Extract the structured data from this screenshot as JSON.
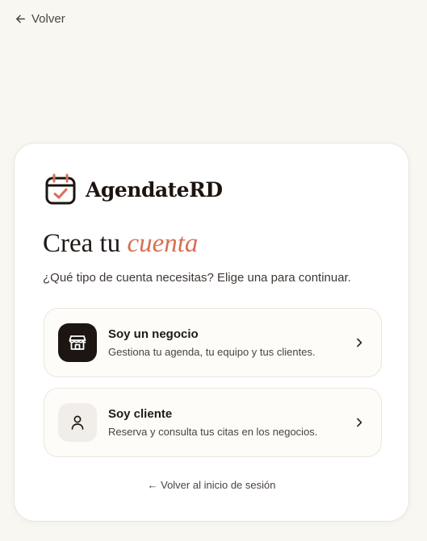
{
  "nav": {
    "back_label": "Volver"
  },
  "brand": {
    "name": "AgendateRD",
    "accent_color": "#d96f52"
  },
  "heading": {
    "title_main": "Crea tu",
    "title_accent": "cuenta",
    "subtitle": "¿Qué tipo de cuenta necesitas? Elige una para continuar."
  },
  "options": [
    {
      "title": "Soy un negocio",
      "description": "Gestiona tu agenda, tu equipo y tus clientes.",
      "icon": "store-icon"
    },
    {
      "title": "Soy cliente",
      "description": "Reserva y consulta tus citas en los negocios.",
      "icon": "user-icon"
    }
  ],
  "footer": {
    "back_login_label": "← Volver al inicio de sesión"
  }
}
